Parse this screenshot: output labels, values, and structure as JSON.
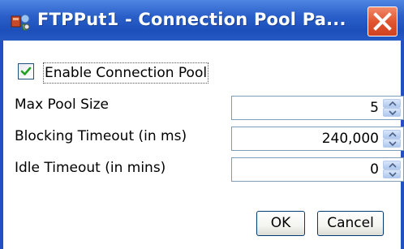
{
  "window": {
    "title": "FTPPut1 - Connection Pool Pa...",
    "title_icon": "connection-pool-icon",
    "close_icon": "close-icon",
    "colors": {
      "titlebar": "#2a5fc9",
      "close": "#e0562f",
      "frame": "#2350c0"
    }
  },
  "pool": {
    "enable_label": "Enable Connection Pool",
    "enabled": true
  },
  "fields": [
    {
      "label": "Max Pool Size",
      "value": "5"
    },
    {
      "label": "Blocking Timeout (in ms)",
      "value": "240,000"
    },
    {
      "label": "Idle Timeout (in mins)",
      "value": "0"
    }
  ],
  "buttons": {
    "ok": "OK",
    "cancel": "Cancel"
  }
}
